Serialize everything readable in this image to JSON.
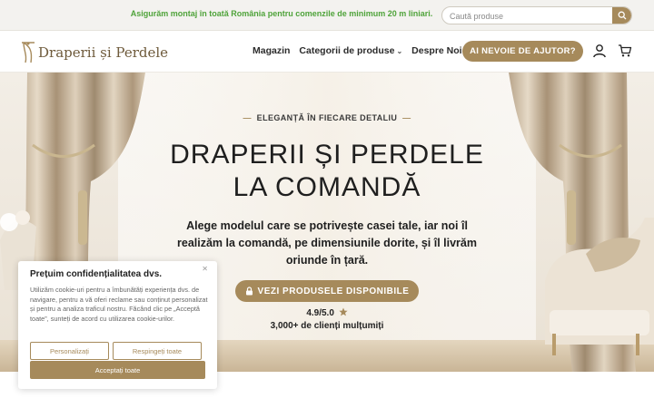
{
  "topbar": {
    "promo": "Asigurăm montaj în toată România pentru comenzile de minimum 20 m liniari.",
    "search_placeholder": "Caută produse"
  },
  "header": {
    "logo_text": "Draperii și Perdele",
    "nav": [
      "Magazin",
      "Categorii de produse",
      "Despre Noi"
    ],
    "help_button": "AI NEVOIE DE AJUTOR?"
  },
  "hero": {
    "eyebrow": "ELEGANȚĂ ÎN FIECARE DETALIU",
    "title_line1": "DRAPERII ȘI PERDELE",
    "title_line2": "LA COMANDĂ",
    "subtitle": "Alege modelul care se potrivește casei tale, iar noi îl realizăm la comandă, pe dimensiunile dorite, și îl livrăm oriunde în țară.",
    "cta": "VEZI PRODUSELE DISPONIBILE",
    "rating": "4.9/5.0",
    "clients": "3,000+ de clienți mulțumiți"
  },
  "cookie": {
    "title": "Prețuim confidențialitatea dvs.",
    "text": "Utilizăm cookie-uri pentru a îmbunătăți experiența dvs. de navigare, pentru a vă oferi reclame sau conținut personalizat și pentru a analiza traficul nostru. Făcând clic pe „Acceptă toate”, sunteți de acord cu utilizarea cookie-urilor.",
    "customize": "Personalizați",
    "reject": "Respingeți toate",
    "accept": "Acceptați toate"
  },
  "colors": {
    "accent": "#a68a5b",
    "promo_green": "#4fa33a",
    "text_dark": "#1f1f1f"
  },
  "icons": [
    "search-icon",
    "user-icon",
    "cart-icon",
    "lock-icon",
    "star-icon",
    "close-icon",
    "chevron-down-icon"
  ]
}
